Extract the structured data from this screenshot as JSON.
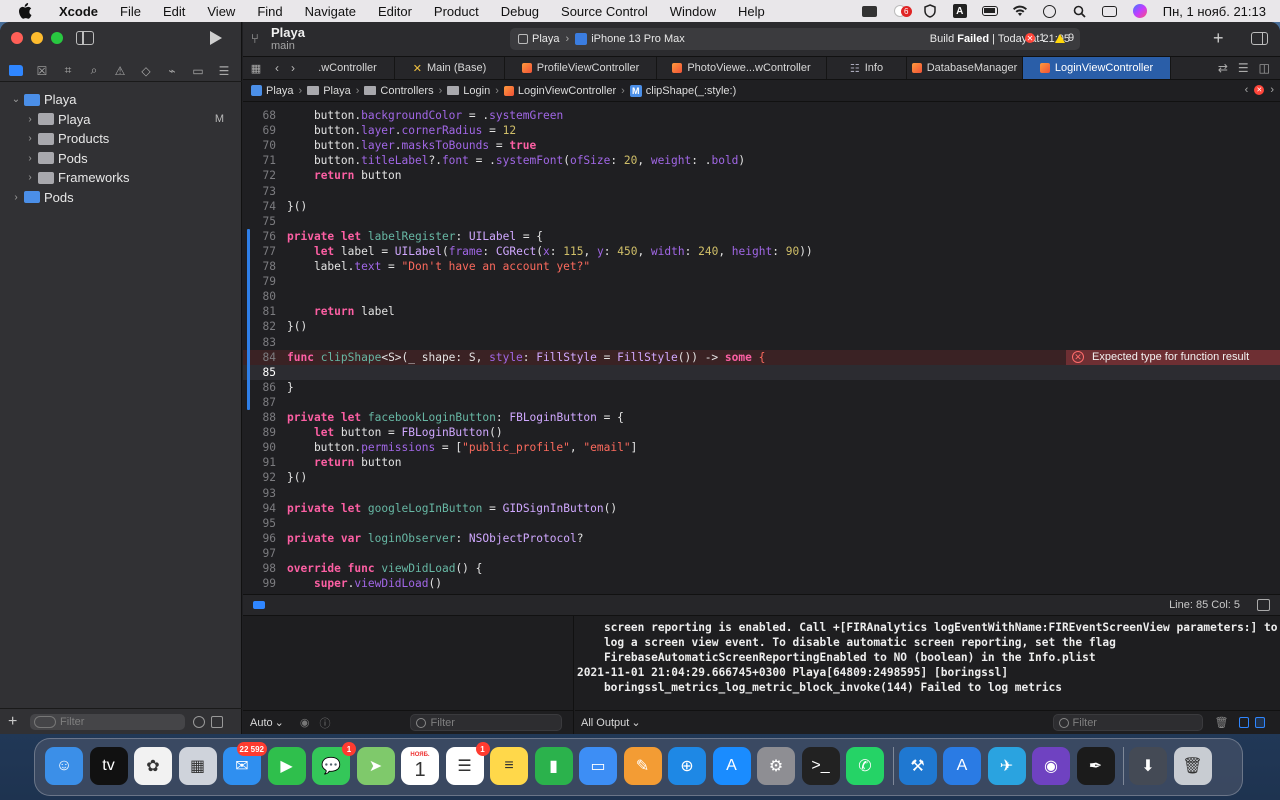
{
  "menubar": {
    "app_name": "Xcode",
    "menus": [
      "File",
      "Edit",
      "View",
      "Find",
      "Navigate",
      "Editor",
      "Product",
      "Debug",
      "Source Control",
      "Window",
      "Help"
    ],
    "notification_badge": "6",
    "clock": "Пн, 1 нояб.  21:13"
  },
  "sidebar": {
    "tree": [
      {
        "label": "Playa",
        "icon": "project-icon",
        "expanded": true,
        "indent": 0,
        "badge": ""
      },
      {
        "label": "Playa",
        "icon": "folder-icon",
        "expanded": false,
        "indent": 1,
        "badge": "M"
      },
      {
        "label": "Products",
        "icon": "folder-icon",
        "expanded": false,
        "indent": 1,
        "badge": ""
      },
      {
        "label": "Pods",
        "icon": "folder-icon",
        "expanded": false,
        "indent": 1,
        "badge": ""
      },
      {
        "label": "Frameworks",
        "icon": "folder-icon",
        "expanded": false,
        "indent": 1,
        "badge": ""
      },
      {
        "label": "Pods",
        "icon": "project-icon",
        "expanded": false,
        "indent": 0,
        "badge": ""
      }
    ],
    "filter_placeholder": "Filter"
  },
  "titlebar": {
    "project": "Playa",
    "branch": "main",
    "scheme": "Playa",
    "device": "iPhone 13 Pro Max",
    "build_status_prefix": "Build ",
    "build_status_word": "Failed",
    "build_status_suffix": " | Today at 21:05",
    "error_count": "1",
    "warning_count": "9"
  },
  "tabs": [
    {
      "label": ".wController",
      "icon": "none",
      "width": 94
    },
    {
      "label": "Main (Base)",
      "icon": "storyboard-icon",
      "width": 110
    },
    {
      "label": "ProfileViewController",
      "icon": "swift-icon",
      "width": 152
    },
    {
      "label": "PhotoViewe...wController",
      "icon": "swift-icon",
      "width": 170
    },
    {
      "label": "Info",
      "icon": "plist-icon",
      "width": 80
    },
    {
      "label": "DatabaseManager",
      "icon": "swift-icon",
      "width": 116
    },
    {
      "label": "LoginViewController",
      "icon": "swift-icon",
      "width": 148,
      "active": true
    }
  ],
  "jumpbar": [
    "Playa",
    "Playa",
    "Controllers",
    "Login",
    "LoginViewController",
    "clipShape(_:style:)"
  ],
  "editor": {
    "error_message": "Expected type for function result",
    "cursor": "Line: 85  Col: 5"
  },
  "console": {
    "lines": [
      "    screen reporting is enabled. Call +[FIRAnalytics logEventWithName:FIREventScreenView parameters:] to",
      "    log a screen view event. To disable automatic screen reporting, set the flag",
      "    FirebaseAutomaticScreenReportingEnabled to NO (boolean) in the Info.plist",
      "2021-11-01 21:04:29.666745+0300 Playa[64809:2498595] [boringssl]",
      "    boringssl_metrics_log_metric_block_invoke(144) Failed to log metrics"
    ],
    "scope": "Auto",
    "output": "All Output",
    "filter_placeholder": "Filter"
  },
  "dock": {
    "apps": [
      {
        "name": "finder-icon",
        "color": "#3b8fe8",
        "glyph": "☺"
      },
      {
        "name": "apple-tv-icon",
        "color": "#111111",
        "glyph": "tv"
      },
      {
        "name": "photos-icon",
        "color": "#f2f2f2",
        "glyph": "✿"
      },
      {
        "name": "launchpad-icon",
        "color": "#cfd3db",
        "glyph": "▦"
      },
      {
        "name": "mail-icon",
        "color": "#2f8ff0",
        "glyph": "✉",
        "badge": "22 592"
      },
      {
        "name": "facetime-icon",
        "color": "#2fbf4c",
        "glyph": "▶"
      },
      {
        "name": "messages-icon",
        "color": "#34c759",
        "glyph": "💬",
        "badge": "1"
      },
      {
        "name": "maps-icon",
        "color": "#7fc96b",
        "glyph": "➤"
      },
      {
        "name": "calendar-icon",
        "color": "#ffffff",
        "glyph": "1",
        "sub": "НОЯБ."
      },
      {
        "name": "reminders-icon",
        "color": "#ffffff",
        "glyph": "☰",
        "badge": "1"
      },
      {
        "name": "notes-icon",
        "color": "#ffd84a",
        "glyph": "≡"
      },
      {
        "name": "numbers-icon",
        "color": "#2bb24c",
        "glyph": "▮"
      },
      {
        "name": "keynote-icon",
        "color": "#3d8ef5",
        "glyph": "▭"
      },
      {
        "name": "pages-icon",
        "color": "#f39c34",
        "glyph": "✎"
      },
      {
        "name": "safari-icon",
        "color": "#1e88e5",
        "glyph": "⊕"
      },
      {
        "name": "app-store-icon",
        "color": "#1a8cff",
        "glyph": "A"
      },
      {
        "name": "system-preferences-icon",
        "color": "#8e8e93",
        "glyph": "⚙"
      },
      {
        "name": "terminal-icon",
        "color": "#222222",
        "glyph": ">_"
      },
      {
        "name": "whatsapp-icon",
        "color": "#25d366",
        "glyph": "✆"
      },
      {
        "name": "xcode-icon",
        "color": "#1f78d1",
        "glyph": "⚒"
      },
      {
        "name": "simulator-icon",
        "color": "#2a7be4",
        "glyph": "A"
      },
      {
        "name": "telegram-icon",
        "color": "#2aa3e0",
        "glyph": "✈"
      },
      {
        "name": "github-icon",
        "color": "#6f42c1",
        "glyph": "◉"
      },
      {
        "name": "pencil-app-icon",
        "color": "#1b1b1b",
        "glyph": "✒"
      },
      {
        "name": "downloads-stack-icon",
        "color": "#444a55",
        "glyph": "⬇"
      },
      {
        "name": "trash-icon",
        "color": "#c8ccd2",
        "glyph": "🗑"
      }
    ]
  }
}
